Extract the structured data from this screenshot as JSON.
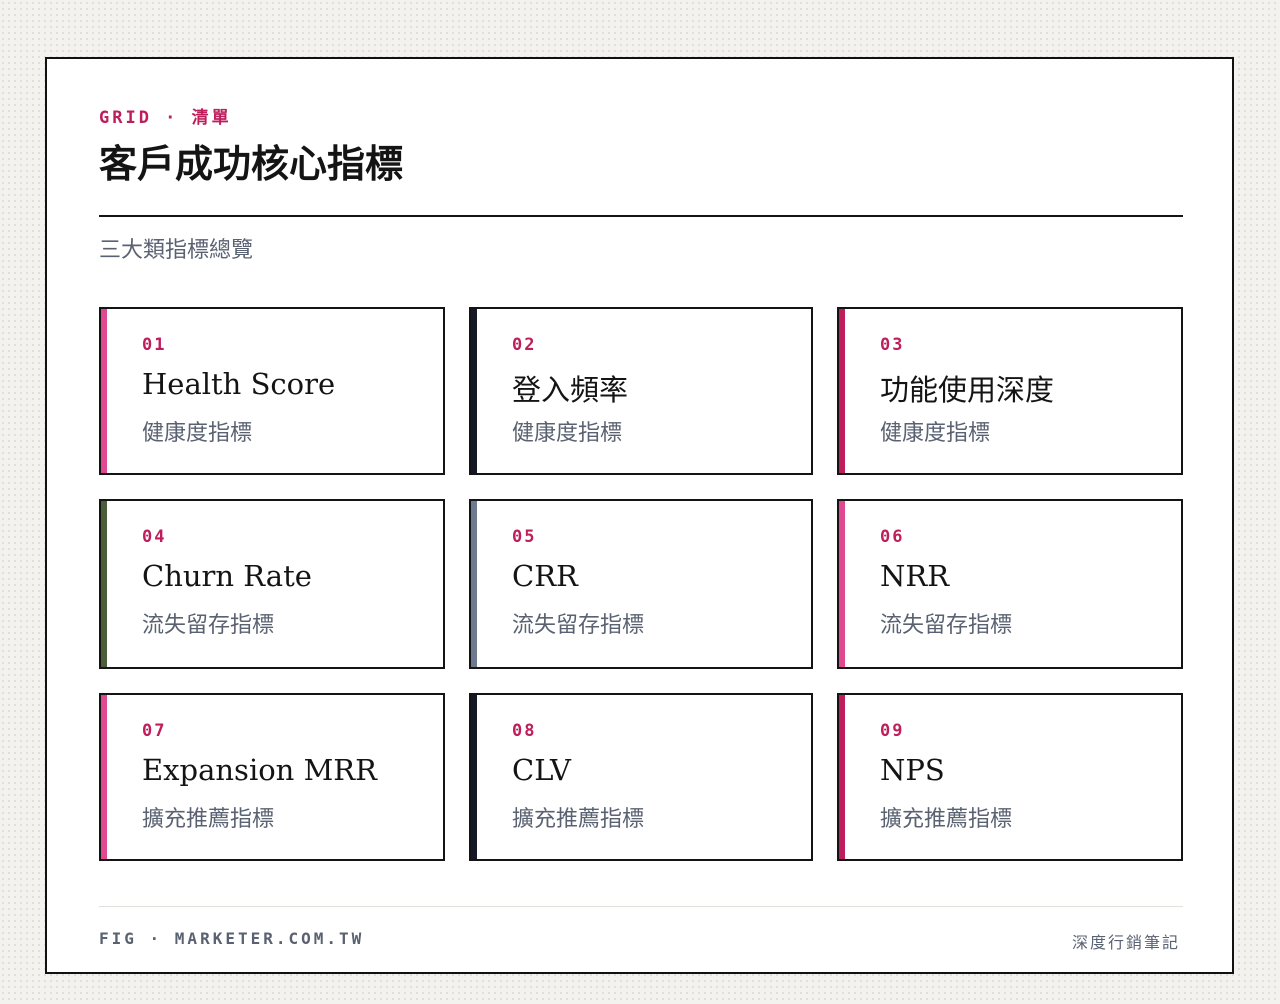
{
  "header": {
    "eyebrow": "GRID · 清單",
    "title": "客戶成功核心指標",
    "subtitle": "三大類指標總覽"
  },
  "colors": {
    "magenta": "#be1e5c",
    "pink": "#e0488f",
    "navy": "#151826",
    "olive": "#4a5e3a",
    "slate": "#6e7a90",
    "text_muted": "#5a6272"
  },
  "cards": [
    {
      "num": "01",
      "name": "Health Score",
      "category": "健康度指標",
      "accent": "#e0488f"
    },
    {
      "num": "02",
      "name": "登入頻率",
      "category": "健康度指標",
      "accent": "#151826"
    },
    {
      "num": "03",
      "name": "功能使用深度",
      "category": "健康度指標",
      "accent": "#be1e5c"
    },
    {
      "num": "04",
      "name": "Churn Rate",
      "category": "流失留存指標",
      "accent": "#4a5e3a"
    },
    {
      "num": "05",
      "name": "CRR",
      "category": "流失留存指標",
      "accent": "#6e7a90"
    },
    {
      "num": "06",
      "name": "NRR",
      "category": "流失留存指標",
      "accent": "#e0488f"
    },
    {
      "num": "07",
      "name": "Expansion MRR",
      "category": "擴充推薦指標",
      "accent": "#e0488f"
    },
    {
      "num": "08",
      "name": "CLV",
      "category": "擴充推薦指標",
      "accent": "#151826"
    },
    {
      "num": "09",
      "name": "NPS",
      "category": "擴充推薦指標",
      "accent": "#be1e5c"
    }
  ],
  "footer": {
    "left": "FIG · MARKETER.COM.TW",
    "right": "深度行銷筆記"
  }
}
